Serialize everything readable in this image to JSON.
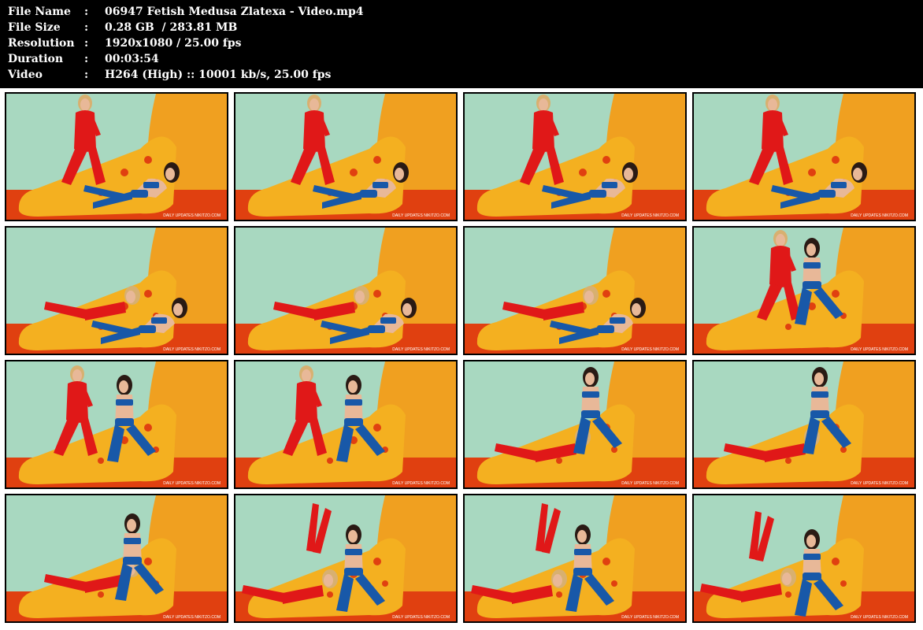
{
  "file_info": {
    "rows": [
      {
        "label": "File Name",
        "value": "06947 Fetish Medusa Zlatexa - Video.mp4"
      },
      {
        "label": "File Size",
        "value": "0.28 GB  / 283.81 MB"
      },
      {
        "label": "Resolution",
        "value": "1920x1080 / 25.00 fps"
      },
      {
        "label": "Duration",
        "value": "00:03:54"
      },
      {
        "label": "Video",
        "value": "H264 (High) :: 10001 kb/s, 25.00 fps"
      }
    ],
    "separator": ":"
  },
  "thumbnails": {
    "watermark": "DAILY UPDATES  NIKITZO.COM",
    "colors": {
      "wall_left": "#a8d8c0",
      "wall_right": "#f0a020",
      "floor": "#e04010",
      "float": "#f4b020",
      "latex_red": "#e01818",
      "latex_blue": "#1858a8",
      "skin": "#e8b898",
      "hair_dark": "#2a1a14",
      "hair_blonde": "#d8b070"
    },
    "poses": [
      "a",
      "a",
      "a",
      "a",
      "b",
      "b",
      "b",
      "c",
      "d",
      "d",
      "e",
      "e",
      "f",
      "g",
      "g",
      "h"
    ]
  }
}
